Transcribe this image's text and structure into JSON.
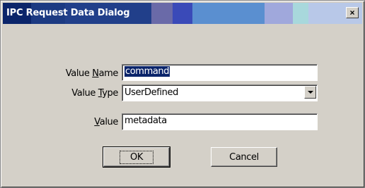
{
  "window": {
    "title": "IPC Request Data Dialog",
    "close_glyph": "×",
    "close_icon": "close-icon"
  },
  "form": {
    "value_name": {
      "label_pre": "Value ",
      "label_accel": "N",
      "label_post": "ame",
      "value": "command"
    },
    "value_type": {
      "label_pre": "Value ",
      "label_accel": "T",
      "label_post": "ype",
      "value": "UserDefined",
      "dropdown_icon": "chevron-down-icon"
    },
    "value": {
      "label_pre": "",
      "label_accel": "V",
      "label_post": "alue",
      "value": "metadata"
    }
  },
  "buttons": {
    "ok": "OK",
    "cancel": "Cancel"
  },
  "colors": {
    "dialog_bg": "#d4d0c8",
    "title_text": "#ffffff",
    "selection_bg": "#0a246a"
  }
}
